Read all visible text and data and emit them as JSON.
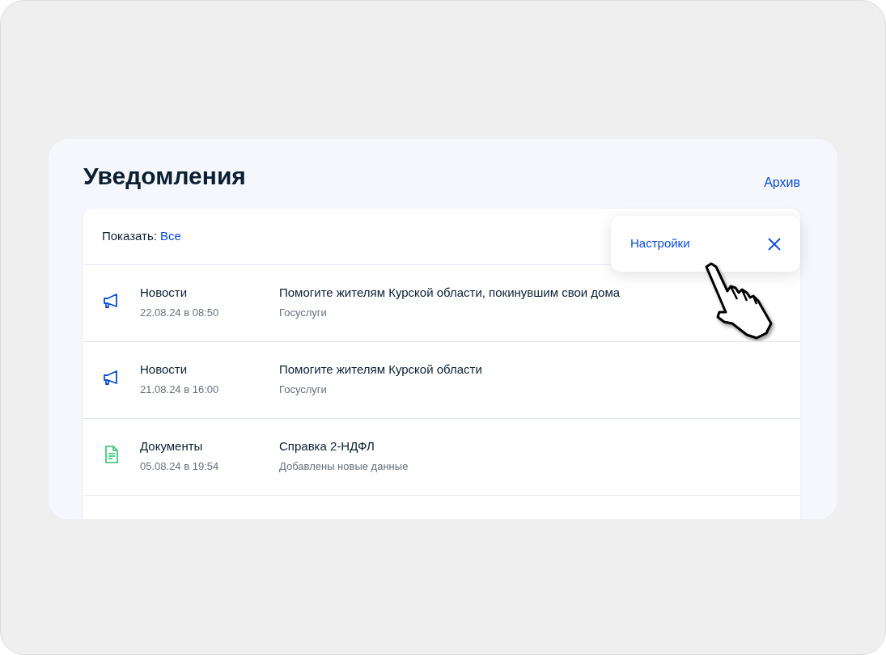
{
  "page": {
    "title": "Уведомления",
    "archive_link": "Архив"
  },
  "filter": {
    "label": "Показать:",
    "value": "Все"
  },
  "popover": {
    "settings_link": "Настройки"
  },
  "notifications": [
    {
      "kind": "news",
      "category": "Новости",
      "date": "22.08.24 в 08:50",
      "title": "Помогите жителям Курской области, покинувшим свои дома",
      "source": "Госуслуги"
    },
    {
      "kind": "news",
      "category": "Новости",
      "date": "21.08.24 в 16:00",
      "title": "Помогите жителям Курской области",
      "source": "Госуслуги"
    },
    {
      "kind": "document",
      "category": "Документы",
      "date": "05.08.24 в 19:54",
      "title": "Справка 2-НДФЛ",
      "source": "Добавлены новые данные"
    }
  ]
}
